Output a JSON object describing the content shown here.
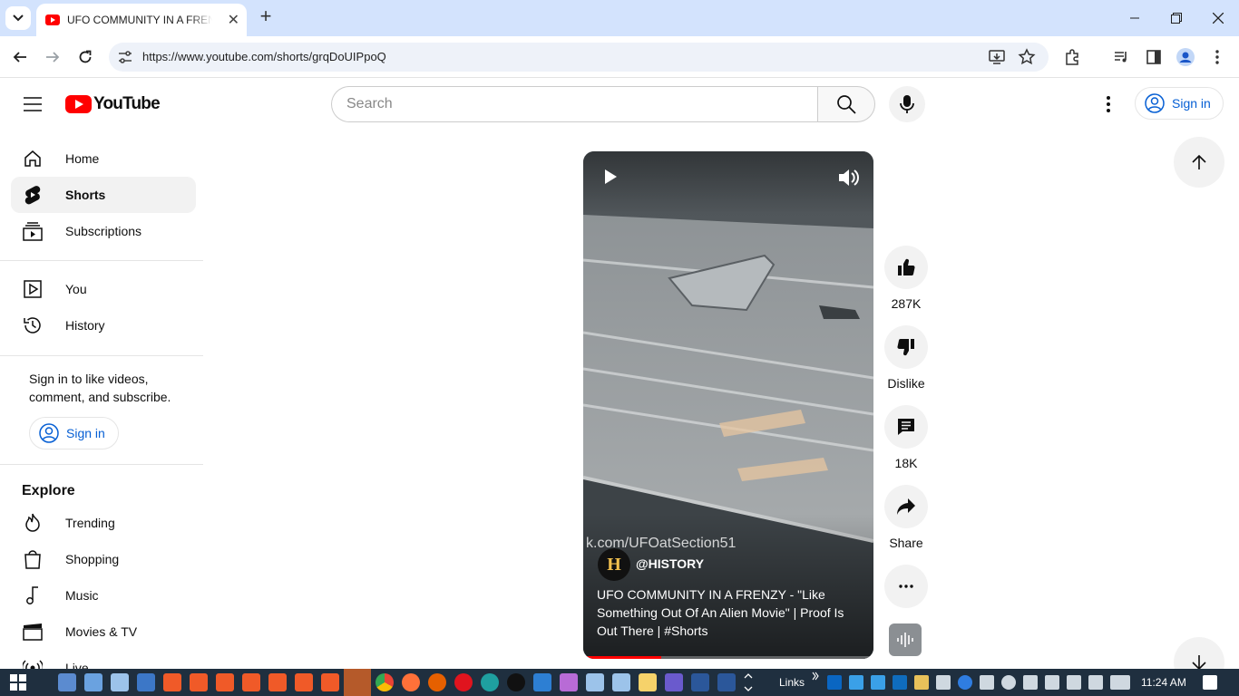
{
  "browser": {
    "tab_title": "UFO COMMUNITY IN A FRENZY - \"Like Something Out Of An Alien Movie\" | Proof Is Out There | #Shorts",
    "url": "https://www.youtube.com/shorts/grqDoUIPpoQ",
    "new_tab": "+",
    "tab_close": "✕"
  },
  "header": {
    "logo_text": "YouTube",
    "search_placeholder": "Search",
    "signin_label": "Sign in"
  },
  "sidebar": {
    "main_items": [
      {
        "label": "Home",
        "icon": "home-icon"
      },
      {
        "label": "Shorts",
        "icon": "shorts-icon",
        "active": true
      },
      {
        "label": "Subscriptions",
        "icon": "subscriptions-icon"
      }
    ],
    "you_items": [
      {
        "label": "You",
        "icon": "you-icon"
      },
      {
        "label": "History",
        "icon": "history-icon"
      }
    ],
    "signin_prompt": "Sign in to like videos, comment, and subscribe.",
    "signin_label": "Sign in",
    "explore_title": "Explore",
    "explore_items": [
      {
        "label": "Trending",
        "icon": "trending-icon"
      },
      {
        "label": "Shopping",
        "icon": "shopping-icon"
      },
      {
        "label": "Music",
        "icon": "music-icon"
      },
      {
        "label": "Movies & TV",
        "icon": "movies-icon"
      },
      {
        "label": "Live",
        "icon": "live-icon"
      }
    ]
  },
  "short": {
    "watermark": "k.com/UFOatSection51",
    "channel": "@HISTORY",
    "channel_avatar_letter": "H",
    "title": "UFO COMMUNITY IN A FRENZY - \"Like Something Out Of An Alien Movie\" | Proof Is Out There | #Shorts",
    "progress": 0.27
  },
  "actions": {
    "likes": "287K",
    "dislike": "Dislike",
    "comments": "18K",
    "share": "Share"
  },
  "taskbar": {
    "links_label": "Links",
    "clock": "11:24 AM"
  },
  "colors": {
    "youtube_red": "#ff0000",
    "link_blue": "#065fd4",
    "chrome_tab_bar": "#d3e3fd",
    "taskbar": "#1f2f3f"
  }
}
